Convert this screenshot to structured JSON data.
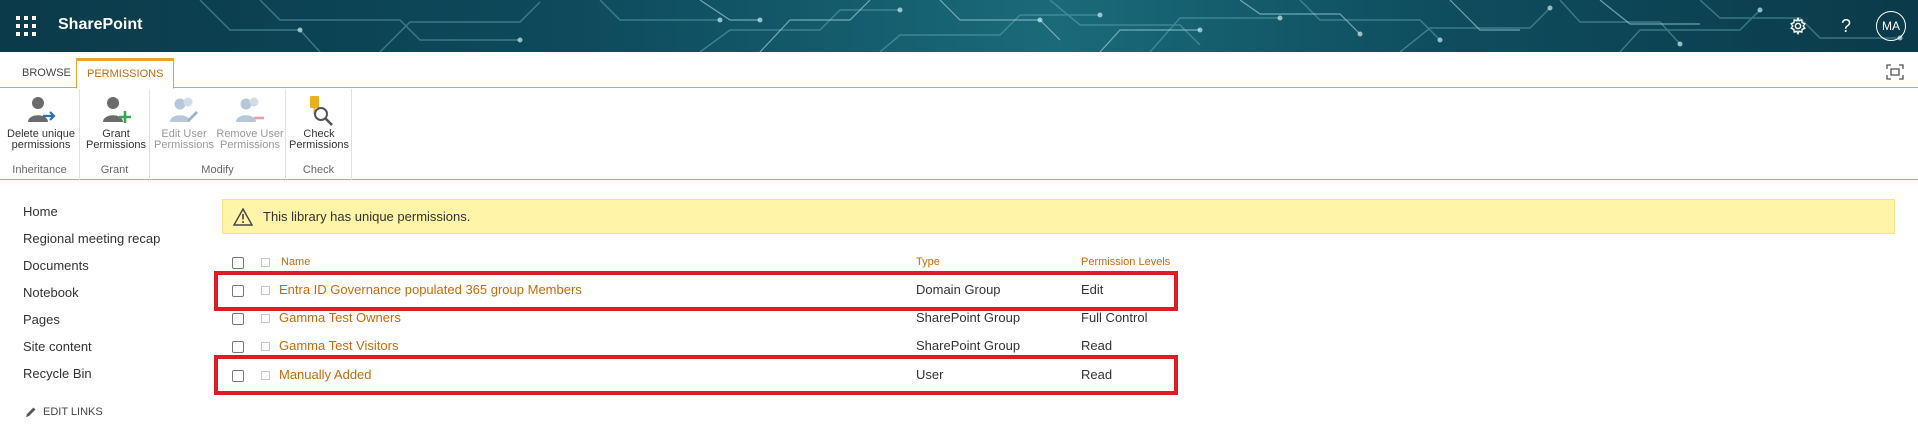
{
  "suite": {
    "brand": "SharePoint",
    "avatar_initials": "MA",
    "help_label": "?"
  },
  "ribbon_tabs": {
    "browse": "BROWSE",
    "permissions": "PERMISSIONS"
  },
  "ribbon": {
    "groups": {
      "inheritance": "Inheritance",
      "grant": "Grant",
      "modify": "Modify",
      "check": "Check"
    },
    "buttons": {
      "delete_unique_1": "Delete unique",
      "delete_unique_2": "permissions",
      "grant_1": "Grant",
      "grant_2": "Permissions",
      "edit_user_1": "Edit User",
      "edit_user_2": "Permissions",
      "remove_user_1": "Remove User",
      "remove_user_2": "Permissions",
      "check_1": "Check",
      "check_2": "Permissions"
    }
  },
  "leftnav": {
    "items": [
      "Home",
      "Regional meeting recap",
      "Documents",
      "Notebook",
      "Pages",
      "Site content",
      "Recycle Bin"
    ],
    "edit_links": "EDIT LINKS"
  },
  "warning": {
    "text": "This library has unique permissions."
  },
  "table": {
    "headers": {
      "name": "Name",
      "type": "Type",
      "levels": "Permission Levels"
    },
    "rows": [
      {
        "name": "Entra ID Governance populated 365 group Members",
        "type": "Domain Group",
        "level": "Edit"
      },
      {
        "name": "Gamma Test Owners",
        "type": "SharePoint Group",
        "level": "Full Control"
      },
      {
        "name": "Gamma Test Visitors",
        "type": "SharePoint Group",
        "level": "Read"
      },
      {
        "name": "Manually Added",
        "type": "User",
        "level": "Read"
      }
    ]
  },
  "colors": {
    "accent": "#c56b0c",
    "ribbon_accent": "#f0a030",
    "warning_bg": "#fff4a8",
    "highlight_border": "#e01b24"
  }
}
